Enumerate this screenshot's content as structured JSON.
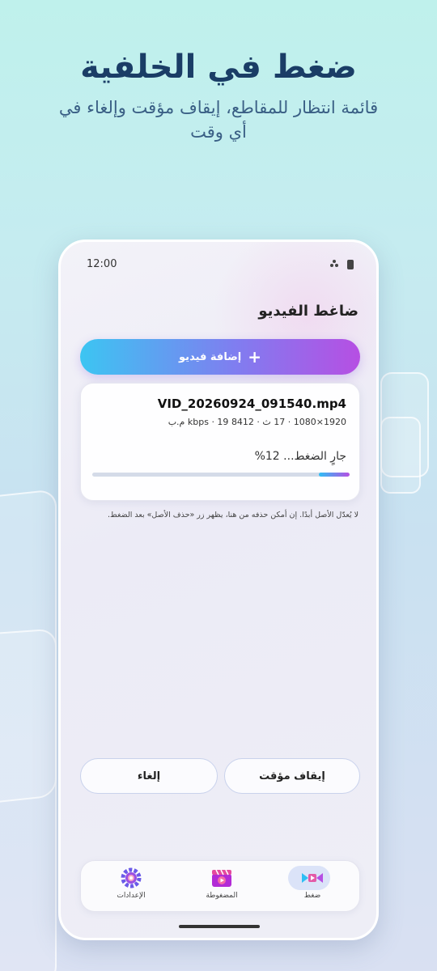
{
  "hero": {
    "title": "ضغط في الخلفية",
    "subtitle": "قائمة انتظار للمقاطع، إيقاف مؤقت وإلغاء في أي وقت"
  },
  "status_bar": {
    "time": "12:00",
    "icons": [
      "signal-icon",
      "battery-icon"
    ]
  },
  "app": {
    "title": "ضاغط الفيديو",
    "add_button_label": "إضافة فيديو",
    "add_button_icon": "plus-icon"
  },
  "job": {
    "file_name": "VID_20260924_091540.mp4",
    "meta": "1920×1080 · 17 ث · 8412 kbps · 19 م.ب",
    "progress_text": "جارٍ الضغط... 12%",
    "progress": 0.12
  },
  "note": "لا يُعدّل الأصل أبدًا. إن أمكن حذفه من هنا، يظهر زر «حذف الأصل» بعد الضغط.",
  "actions": {
    "pause_label": "إيقاف مؤقت",
    "cancel_label": "إلغاء"
  },
  "bottom_nav": {
    "items": [
      {
        "label": "ضغط",
        "icon": "compress-icon",
        "active": true
      },
      {
        "label": "المضغوطة",
        "icon": "clapperboard-icon",
        "active": false
      },
      {
        "label": "الإعدادات",
        "icon": "gear-icon",
        "active": false
      }
    ]
  },
  "colors": {
    "accent_start": "#3cc5f2",
    "accent_end": "#b64fe3",
    "title": "#1a3d66"
  }
}
